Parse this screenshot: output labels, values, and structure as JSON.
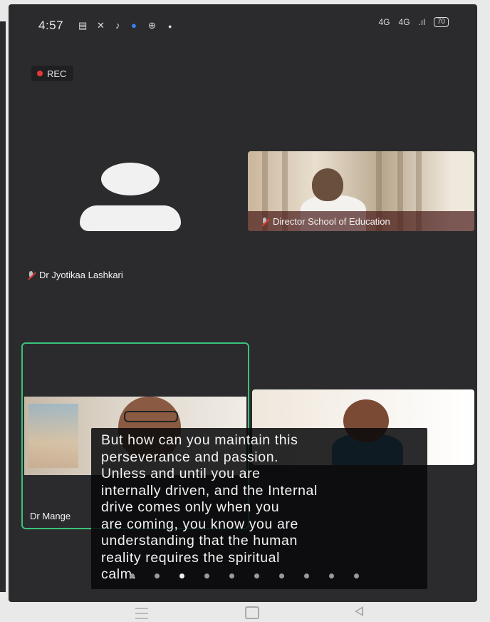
{
  "status_bar": {
    "time": "4:57",
    "left_icons": [
      "notification-icon",
      "missed-call-icon",
      "music-icon",
      "app-icon",
      "app-icon-2",
      "dot-icon"
    ],
    "network_1": "4G",
    "network_2": "4G",
    "battery": "70"
  },
  "recording": {
    "label": "REC",
    "color": "#e53935"
  },
  "participants": {
    "jyotikaa": {
      "name": "Dr Jyotikaa Lashkari",
      "muted": true,
      "video": false
    },
    "director": {
      "name": "Director School of Education",
      "muted": true,
      "video": true
    },
    "mange": {
      "name": "Dr Mange",
      "active_speaker": true,
      "border_color": "#39c27a"
    }
  },
  "caption": {
    "lines": [
      "But how can you maintain this",
      "perseverance and passion.",
      "Unless and until you are",
      "internally driven, and the Internal",
      "drive comes only when you",
      "are coming, you know you are",
      "understanding that the human",
      "reality requires the spiritual",
      "calm."
    ]
  },
  "pagination": {
    "total": 10,
    "active": 3
  },
  "nav": {
    "buttons": [
      "menu-icon",
      "home-icon",
      "back-icon"
    ]
  }
}
